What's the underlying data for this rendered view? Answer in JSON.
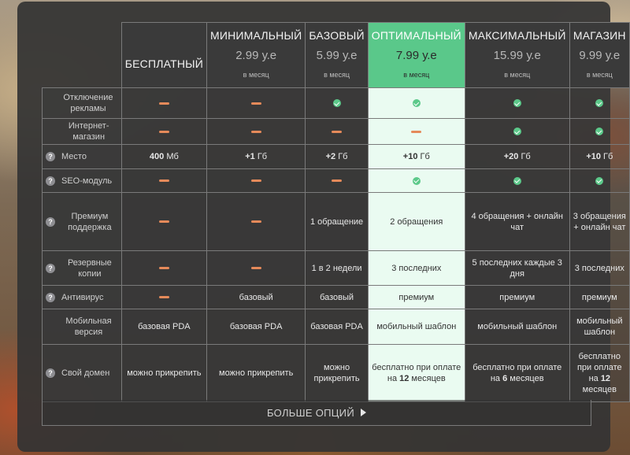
{
  "colors": {
    "accent": "#5ac88a",
    "dash": "#e58a5a",
    "check": "#5cc98a"
  },
  "plans": [
    {
      "name": "БЕСПЛАТНЫЙ",
      "price": "",
      "period": ""
    },
    {
      "name": "МИНИМАЛЬНЫЙ",
      "price": "2.99 у.е",
      "period": "в месяц"
    },
    {
      "name": "БАЗОВЫЙ",
      "price": "5.99 у.е",
      "period": "в месяц"
    },
    {
      "name": "ОПТИМАЛЬНЫЙ",
      "price": "7.99 у.е",
      "period": "в месяц",
      "highlighted": true
    },
    {
      "name": "МАКСИМАЛЬНЫЙ",
      "price": "15.99 у.е",
      "period": "в месяц"
    },
    {
      "name": "МАГАЗИН",
      "price": "9.99 у.е",
      "period": "в месяц"
    }
  ],
  "features": [
    {
      "label": "Отключение рекламы",
      "help": false,
      "cells": [
        {
          "t": "dash"
        },
        {
          "t": "dash"
        },
        {
          "t": "check"
        },
        {
          "t": "check"
        },
        {
          "t": "check"
        },
        {
          "t": "check"
        }
      ]
    },
    {
      "label": "Интернет-магазин",
      "help": false,
      "cells": [
        {
          "t": "dash"
        },
        {
          "t": "dash"
        },
        {
          "t": "dash"
        },
        {
          "t": "dash"
        },
        {
          "t": "check"
        },
        {
          "t": "check"
        }
      ]
    },
    {
      "label": "Место",
      "help": true,
      "cells": [
        {
          "t": "text",
          "b": "400",
          "v": " Мб"
        },
        {
          "t": "text",
          "b": "+1",
          "v": " Гб"
        },
        {
          "t": "text",
          "b": "+2",
          "v": " Гб"
        },
        {
          "t": "text",
          "b": "+10",
          "v": " Гб"
        },
        {
          "t": "text",
          "b": "+20",
          "v": " Гб"
        },
        {
          "t": "text",
          "b": "+10",
          "v": " Гб"
        }
      ]
    },
    {
      "label": "SEO-модуль",
      "help": true,
      "cells": [
        {
          "t": "dash"
        },
        {
          "t": "dash"
        },
        {
          "t": "dash"
        },
        {
          "t": "check"
        },
        {
          "t": "check"
        },
        {
          "t": "check"
        }
      ]
    },
    {
      "label": "Премиум поддержка",
      "help": true,
      "cells": [
        {
          "t": "dash"
        },
        {
          "t": "dash"
        },
        {
          "t": "text",
          "v": "1 обращение"
        },
        {
          "t": "text",
          "v": "2 обращения"
        },
        {
          "t": "text",
          "v": "4 обращения + онлайн чат"
        },
        {
          "t": "text",
          "v": "3 обращения + онлайн чат"
        }
      ]
    },
    {
      "label": "Резервные копии",
      "help": true,
      "cells": [
        {
          "t": "dash"
        },
        {
          "t": "dash"
        },
        {
          "t": "text",
          "v": "1 в 2 недели"
        },
        {
          "t": "text",
          "v": "3 последних"
        },
        {
          "t": "text",
          "v": "5 последних каждые 3 дня"
        },
        {
          "t": "text",
          "v": "3 последних"
        }
      ]
    },
    {
      "label": "Антивирус",
      "help": true,
      "cells": [
        {
          "t": "dash"
        },
        {
          "t": "text",
          "v": "базовый"
        },
        {
          "t": "text",
          "v": "базовый"
        },
        {
          "t": "text",
          "v": "премиум"
        },
        {
          "t": "text",
          "v": "премиум"
        },
        {
          "t": "text",
          "v": "премиум"
        }
      ]
    },
    {
      "label": "Мобильная версия",
      "help": false,
      "cells": [
        {
          "t": "text",
          "v": "базовая PDA"
        },
        {
          "t": "text",
          "v": "базовая PDA"
        },
        {
          "t": "text",
          "v": "базовая PDA"
        },
        {
          "t": "text",
          "v": "мобильный шаблон"
        },
        {
          "t": "text",
          "v": "мобильный шаблон"
        },
        {
          "t": "text",
          "v": "мобильный шаблон"
        }
      ]
    },
    {
      "label": "Свой домен",
      "help": true,
      "cells": [
        {
          "t": "text",
          "v": "можно прикрепить"
        },
        {
          "t": "text",
          "v": "можно прикрепить"
        },
        {
          "t": "text",
          "v": "можно прикрепить"
        },
        {
          "t": "rich",
          "v": "бесплатно при оплате на ",
          "b": "12",
          "v2": " месяцев"
        },
        {
          "t": "rich",
          "v": "бесплатно при оплате на ",
          "b": "6",
          "v2": " месяцев"
        },
        {
          "t": "rich",
          "v": "бесплатно при оплате на ",
          "b": "12",
          "v2": " месяцев"
        }
      ]
    }
  ],
  "help_glyph": "?",
  "more_options": {
    "label": "БОЛЬШЕ ОПЦИЙ",
    "icon": "play-arrow-icon"
  }
}
